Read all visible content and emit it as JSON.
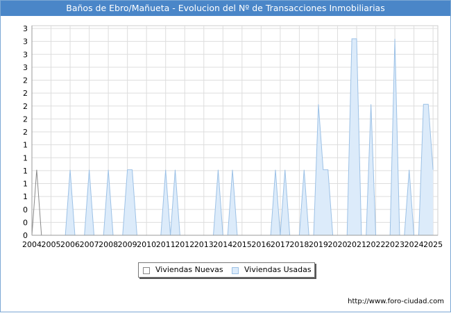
{
  "chart_data": {
    "type": "area",
    "title": "Baños de Ebro/Mañueta - Evolucion del Nº de Transacciones Inmobiliarias",
    "x_labels": [
      "2004",
      "2005",
      "2006",
      "2007",
      "2008",
      "2009",
      "2010",
      "2011",
      "2012",
      "2013",
      "2014",
      "2015",
      "2016",
      "2017",
      "2018",
      "2019",
      "2020",
      "2021",
      "2022",
      "2023",
      "2024",
      "2025"
    ],
    "y_tick_labels": [
      "0",
      "0",
      "0",
      "1",
      "1",
      "1",
      "1",
      "1",
      "2",
      "2",
      "2",
      "2",
      "2",
      "3",
      "3",
      "3",
      "3"
    ],
    "ylim": [
      0,
      3.2
    ],
    "x_range": [
      2004,
      2025.25
    ],
    "grid": true,
    "legend_position": "bottom",
    "series": [
      {
        "name": "Viviendas Nuevas",
        "color": "#888888",
        "fill": "none",
        "points": [
          [
            2004.0,
            0
          ],
          [
            2004.25,
            1
          ],
          [
            2004.5,
            0
          ],
          [
            2025.25,
            0
          ]
        ]
      },
      {
        "name": "Viviendas Usadas",
        "color": "#9cc1e6",
        "fill": "#dcebfa",
        "points": [
          [
            2004.0,
            0
          ],
          [
            2005.75,
            0
          ],
          [
            2006.0,
            1
          ],
          [
            2006.25,
            0
          ],
          [
            2006.75,
            0
          ],
          [
            2007.0,
            1
          ],
          [
            2007.25,
            0
          ],
          [
            2007.75,
            0
          ],
          [
            2008.0,
            1
          ],
          [
            2008.25,
            0
          ],
          [
            2008.75,
            0
          ],
          [
            2009.0,
            1
          ],
          [
            2009.25,
            1
          ],
          [
            2009.5,
            0
          ],
          [
            2010.75,
            0
          ],
          [
            2011.0,
            1
          ],
          [
            2011.25,
            0
          ],
          [
            2011.5,
            1
          ],
          [
            2011.75,
            0
          ],
          [
            2013.5,
            0
          ],
          [
            2013.75,
            1
          ],
          [
            2014.0,
            0
          ],
          [
            2014.25,
            0
          ],
          [
            2014.5,
            1
          ],
          [
            2014.75,
            0
          ],
          [
            2016.5,
            0
          ],
          [
            2016.75,
            1
          ],
          [
            2017.0,
            0
          ],
          [
            2017.25,
            1
          ],
          [
            2017.5,
            0
          ],
          [
            2018.0,
            0
          ],
          [
            2018.25,
            1
          ],
          [
            2018.5,
            0
          ],
          [
            2018.75,
            0
          ],
          [
            2019.0,
            2
          ],
          [
            2019.25,
            1
          ],
          [
            2019.5,
            1
          ],
          [
            2019.75,
            0
          ],
          [
            2020.5,
            0
          ],
          [
            2020.75,
            3
          ],
          [
            2021.0,
            3
          ],
          [
            2021.25,
            0
          ],
          [
            2021.5,
            0
          ],
          [
            2021.75,
            2
          ],
          [
            2022.0,
            0
          ],
          [
            2022.75,
            0
          ],
          [
            2023.0,
            3
          ],
          [
            2023.25,
            0
          ],
          [
            2023.5,
            0
          ],
          [
            2023.75,
            1
          ],
          [
            2024.0,
            0
          ],
          [
            2024.25,
            0
          ],
          [
            2024.5,
            2
          ],
          [
            2024.75,
            2
          ],
          [
            2025.0,
            1
          ]
        ]
      }
    ]
  },
  "legend": [
    {
      "label": "Viviendas Nuevas",
      "color": "#888888",
      "fill": "#ffffff"
    },
    {
      "label": "Viviendas Usadas",
      "color": "#9cc1e6",
      "fill": "#dcebfa"
    }
  ],
  "footer": {
    "url": "http://www.foro-ciudad.com"
  }
}
